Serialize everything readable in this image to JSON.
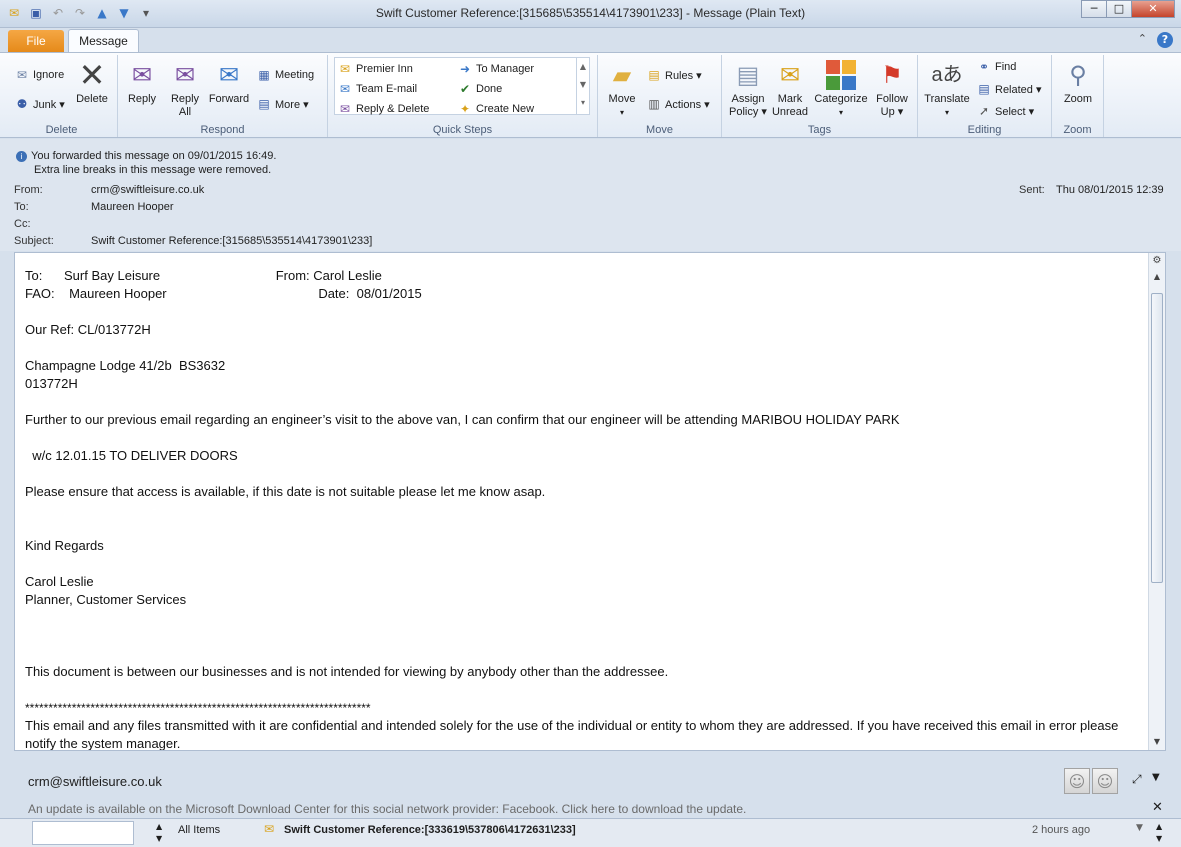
{
  "window": {
    "title": "Swift Customer Reference:[315685\\535514\\4173901\\233]  - Message (Plain Text)",
    "minimize": "─",
    "maximize": "□",
    "close": "✕"
  },
  "tabs": {
    "file": "File",
    "message": "Message"
  },
  "ribbon": {
    "delete_group": {
      "label": "Delete",
      "ignore": "Ignore",
      "junk": "Junk ▾",
      "delete": "Delete"
    },
    "respond_group": {
      "label": "Respond",
      "reply": "Reply",
      "reply_all_1": "Reply",
      "reply_all_2": "All",
      "forward": "Forward",
      "meeting": "Meeting",
      "more": "More ▾"
    },
    "quick_steps": {
      "label": "Quick Steps",
      "items": [
        "Premier Inn",
        "Team E-mail",
        "Reply & Delete",
        "To Manager",
        "Done",
        "Create New"
      ]
    },
    "move_group": {
      "label": "Move",
      "move": "Move",
      "rules": "Rules ▾",
      "actions": "Actions ▾"
    },
    "tags_group": {
      "label": "Tags",
      "assign_1": "Assign",
      "assign_2": "Policy ▾",
      "mark_1": "Mark",
      "mark_2": "Unread",
      "categorize": "Categorize",
      "follow_1": "Follow",
      "follow_2": "Up ▾"
    },
    "editing_group": {
      "label": "Editing",
      "translate": "Translate",
      "find": "Find",
      "related": "Related ▾",
      "select": "Select ▾"
    },
    "zoom_group": {
      "label": "Zoom",
      "zoom": "Zoom"
    }
  },
  "info": {
    "forwarded": "You forwarded this message on 09/01/2015 16:49.",
    "linebreaks": "Extra line breaks in this message were removed."
  },
  "header": {
    "from_label": "From:",
    "from_value": "crm@swiftleisure.co.uk",
    "to_label": "To:",
    "to_value": "Maureen Hooper",
    "cc_label": "Cc:",
    "subject_label": "Subject:",
    "subject_value": "Swift Customer Reference:[315685\\535514\\4173901\\233]",
    "sent_label": "Sent:",
    "sent_value": "Thu 08/01/2015 12:39"
  },
  "body": {
    "l1": "To:      Surf Bay Leisure                                From: Carol Leslie",
    "l2": "FAO:    Maureen Hooper                                          Date:  08/01/2015",
    "ref": "Our Ref: CL/013772H",
    "van1": "Champagne Lodge 41/2b  BS3632",
    "van2": "013772H",
    "para1": "Further to our previous email regarding an engineer’s visit to the above van, I can confirm that our engineer will be attending MARIBOU HOLIDAY PARK",
    "para2": "  w/c 12.01.15 TO DELIVER DOORS",
    "para3": "Please ensure that access is available, if this date is not suitable please let me know asap.",
    "regards": "Kind Regards",
    "sig1": "Carol Leslie",
    "sig2": "Planner, Customer Services",
    "disclaimer1": "This document is between our businesses and is not intended for viewing by anybody other than the addressee.",
    "stars": "**************************************************************************",
    "disclaimer2": "This email and any files transmitted with it are confidential and intended solely for the use of the individual or entity to whom they are addressed. If you have received this email in error please notify the system manager."
  },
  "people_pane": {
    "address": "crm@swiftleisure.co.uk",
    "update": "An update is available on the Microsoft Download Center for this social network provider: Facebook. Click here to download the update.",
    "close": "✕"
  },
  "bottom": {
    "all_items": "All Items",
    "item_subject": "Swift Customer Reference:[333619\\537806\\4172631\\233]",
    "item_time": "2 hours ago"
  }
}
